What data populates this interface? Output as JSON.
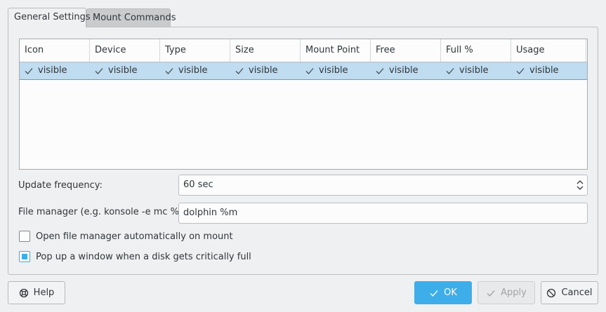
{
  "tabs": [
    {
      "label": "General Settings",
      "active": true
    },
    {
      "label": "Mount Commands",
      "active": false
    }
  ],
  "table": {
    "columns": [
      "Icon",
      "Device",
      "Type",
      "Size",
      "Mount Point",
      "Free",
      "Full %",
      "Usage"
    ],
    "rows": [
      [
        "visible",
        "visible",
        "visible",
        "visible",
        "visible",
        "visible",
        "visible",
        "visible"
      ]
    ]
  },
  "form": {
    "update_frequency_label": "Update frequency:",
    "update_frequency_value": "60 sec",
    "file_manager_label": "File manager (e.g. konsole -e mc %m):",
    "file_manager_value": "dolphin %m",
    "open_fm_label": "Open file manager automatically on mount",
    "open_fm_checked": false,
    "popup_label": "Pop up a window when a disk gets critically full",
    "popup_checked": true
  },
  "buttons": {
    "help": "Help",
    "ok": "OK",
    "apply": "Apply",
    "cancel": "Cancel"
  },
  "colors": {
    "accent": "#3daee9",
    "selection": "#bfdcf0",
    "window_bg": "#eff0f1"
  },
  "icons": {
    "check": "check-icon",
    "help": "lifebuoy-icon",
    "ok": "check-icon",
    "apply": "check-icon",
    "cancel": "cancel-icon",
    "spin": "spinbox-arrows-icon"
  }
}
